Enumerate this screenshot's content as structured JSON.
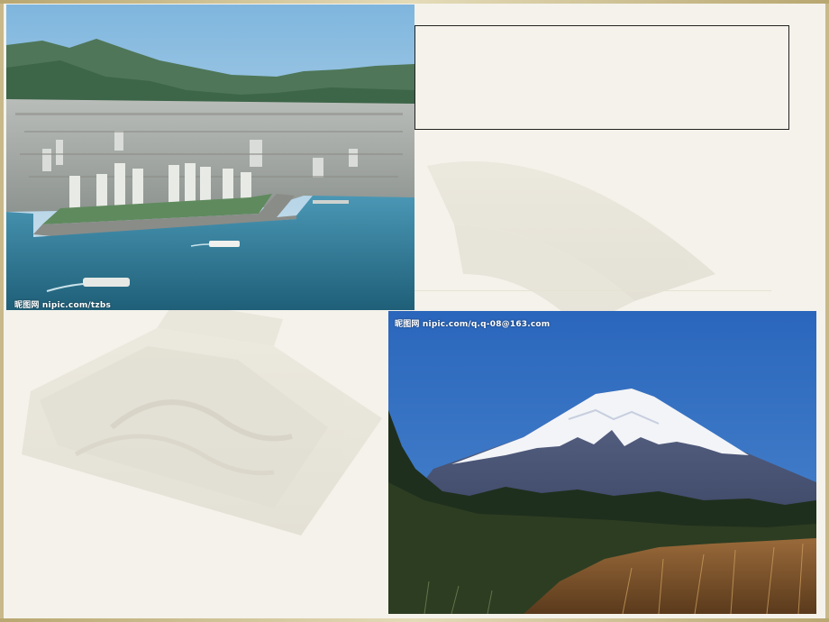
{
  "slide": {
    "text_box_content": ""
  },
  "photos": {
    "city": {
      "description_icon": "coastal-city-photo",
      "watermark": "昵图网 nipic.com/tzbs"
    },
    "fuji": {
      "description_icon": "mount-fuji-photo",
      "watermark": "昵图网 nipic.com/q.q-08@163.com"
    }
  },
  "colors": {
    "frame": "#c9b98a",
    "background": "#f4f2ea",
    "sea": "#2f7c99",
    "sky": "#2e6fc4"
  }
}
